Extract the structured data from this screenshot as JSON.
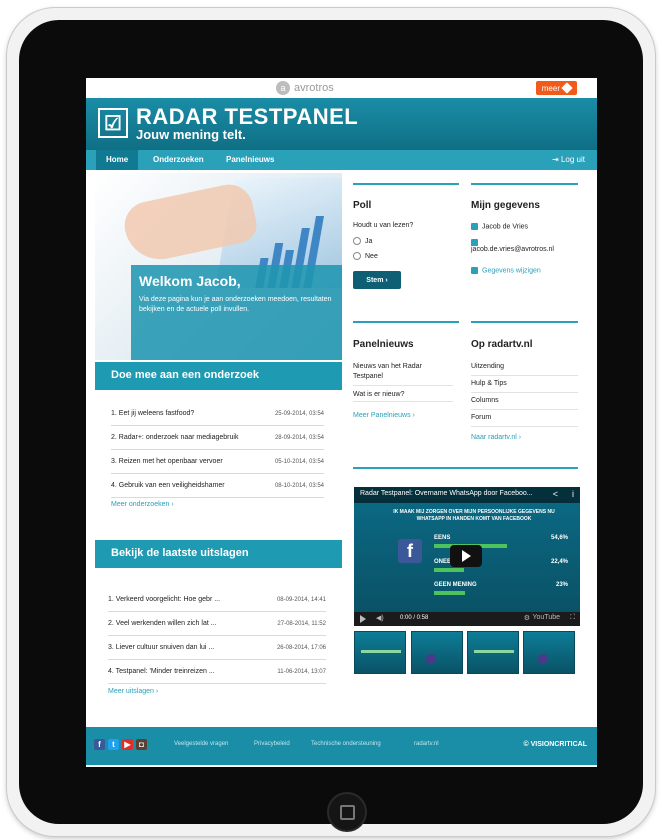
{
  "brand": {
    "name": "avrotros",
    "logo_letter": "a"
  },
  "top_button": {
    "label": "meer"
  },
  "header": {
    "title": "RADAR TESTPANEL",
    "tagline": "Jouw mening telt.",
    "logo_glyph": "☑"
  },
  "nav": {
    "items": [
      {
        "label": "Home",
        "active": true
      },
      {
        "label": "Onderzoeken",
        "active": false
      },
      {
        "label": "Panelnieuws",
        "active": false
      }
    ],
    "logout_label": "⇥ Log uit"
  },
  "hero": {
    "title": "Welkom Jacob,",
    "text": "Via deze pagina kun je aan onderzoeken meedoen, resultaten bekijken en de actuele poll invullen."
  },
  "surveys": {
    "heading": "Doe mee aan een onderzoek",
    "items": [
      {
        "label": "1. Eet jij weleens fastfood?",
        "date": "25-09-2014, 03:54"
      },
      {
        "label": "2. Radar+: onderzoek naar mediagebruik",
        "date": "28-09-2014, 03:54"
      },
      {
        "label": "3. Reizen met het openbaar vervoer",
        "date": "05-10-2014, 03:54"
      },
      {
        "label": "4. Gebruik van een veiligheidshamer",
        "date": "08-10-2014, 03:54"
      }
    ],
    "more_link": "Meer onderzoeken ›"
  },
  "results": {
    "heading": "Bekijk de laatste uitslagen",
    "items": [
      {
        "label": "1. Verkeerd voorgelicht: Hoe gebr ...",
        "date": "08-09-2014, 14:41"
      },
      {
        "label": "2. Veel werkenden willen zich lat ...",
        "date": "27-08-2014, 11:52"
      },
      {
        "label": "3. Liever cultuur snuiven dan lui ...",
        "date": "26-08-2014, 17:06"
      },
      {
        "label": "4. Testpanel: 'Minder treinreizen ...",
        "date": "11-06-2014, 13:07"
      }
    ],
    "more_link": "Meer uitslagen ›"
  },
  "poll": {
    "title": "Poll",
    "question": "Houdt u van lezen?",
    "options": [
      "Ja",
      "Nee"
    ],
    "submit_label": "Stem ›"
  },
  "account": {
    "title": "Mijn gegevens",
    "name": "Jacob de Vries",
    "email": "jacob.de.vries@avrotros.nl",
    "edit_link": "Gegevens wijzigen"
  },
  "panel_news": {
    "title": "Panelnieuws",
    "items": [
      "Nieuws van het Radar Testpanel",
      "Wat is er nieuw?"
    ],
    "more_link": "Meer Panelnieuws ›"
  },
  "radartv": {
    "title": "Op radartv.nl",
    "items": [
      "Uitzending",
      "Hulp & Tips",
      "Columns",
      "Forum"
    ],
    "more_link": "Naar radartv.nl ›"
  },
  "video": {
    "title": "Radar Testpanel: Overname WhatsApp door Faceboo...",
    "headline": "IK MAAK MIJ ZORGEN OVER MIJN PERSOONLIJKE GEGEVENS NU WHATSAPP IN HANDEN KOMT VAN FACEBOOK",
    "rows": [
      {
        "label": "EENS",
        "pct": "54,6%",
        "value": 54.6
      },
      {
        "label": "ONEENS",
        "pct": "22,4%",
        "value": 22.4
      },
      {
        "label": "GEEN MENING",
        "pct": "23%",
        "value": 23
      }
    ],
    "time": "0:00 / 0:58",
    "share_glyph": "<",
    "info_glyph": "i",
    "yt_label": "YouTube",
    "gear_glyph": "⚙",
    "full_glyph": "⛶",
    "vol_glyph": "◀)"
  },
  "footer": {
    "links": [
      "Veelgestelde vragen",
      "Privacybeleid",
      "Technische ondersteuning",
      "radartv.nl"
    ],
    "brand": "© VISIONCRITICAL",
    "social": [
      "f",
      "t",
      "▶",
      "◘"
    ]
  }
}
